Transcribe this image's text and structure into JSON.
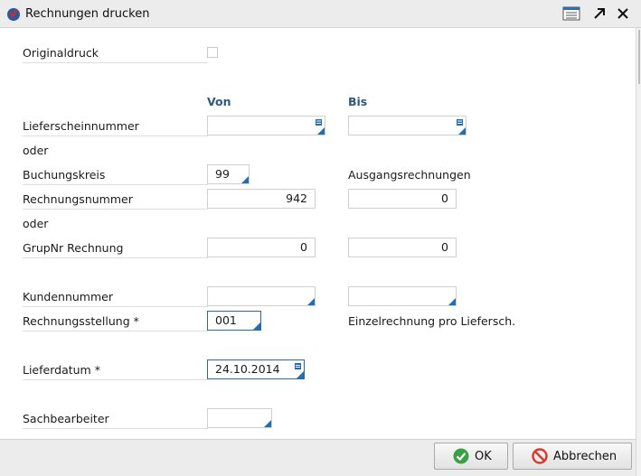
{
  "window": {
    "title": "Rechnungen drucken"
  },
  "columns": {
    "from": "Von",
    "to": "Bis"
  },
  "labels": {
    "originaldruck": "Originaldruck",
    "lieferscheinnummer": "Lieferscheinnummer",
    "oder1": "oder",
    "buchungskreis": "Buchungskreis",
    "rechnungsnummer": "Rechnungsnummer",
    "oder2": "oder",
    "grupnr": "GrupNr Rechnung",
    "kundennummer": "Kundennummer",
    "rechnungsstellung": "Rechnungsstellung *",
    "lieferdatum": "Lieferdatum *",
    "sachbearbeiter": "Sachbearbeiter"
  },
  "values": {
    "originaldruck_checked": false,
    "lieferschein_von": "",
    "lieferschein_bis": "",
    "buchungskreis": "99",
    "buchungskreis_desc": "Ausgangsrechnungen",
    "rechnungsnummer_von": "942",
    "rechnungsnummer_bis": "0",
    "grupnr_von": "0",
    "grupnr_bis": "0",
    "kunden_von": "",
    "kunden_bis": "",
    "rechnungsstellung": "001",
    "rechnungsstellung_desc": "Einzelrechnung pro Liefersch.",
    "lieferdatum": "24.10.2014",
    "sachbearbeiter": ""
  },
  "buttons": {
    "ok": "OK",
    "cancel": "Abbrechen"
  },
  "icons": {
    "app": "app-logo-icon",
    "layout": "layout-icon",
    "expand": "expand-arrow-icon",
    "close": "close-icon",
    "ok": "check-circle-icon",
    "cancel": "no-entry-icon"
  },
  "colors": {
    "accent": "#1f6fb2",
    "header": "#2a5a80",
    "ok_green": "#3aa046",
    "cancel_red": "#d9382a"
  }
}
